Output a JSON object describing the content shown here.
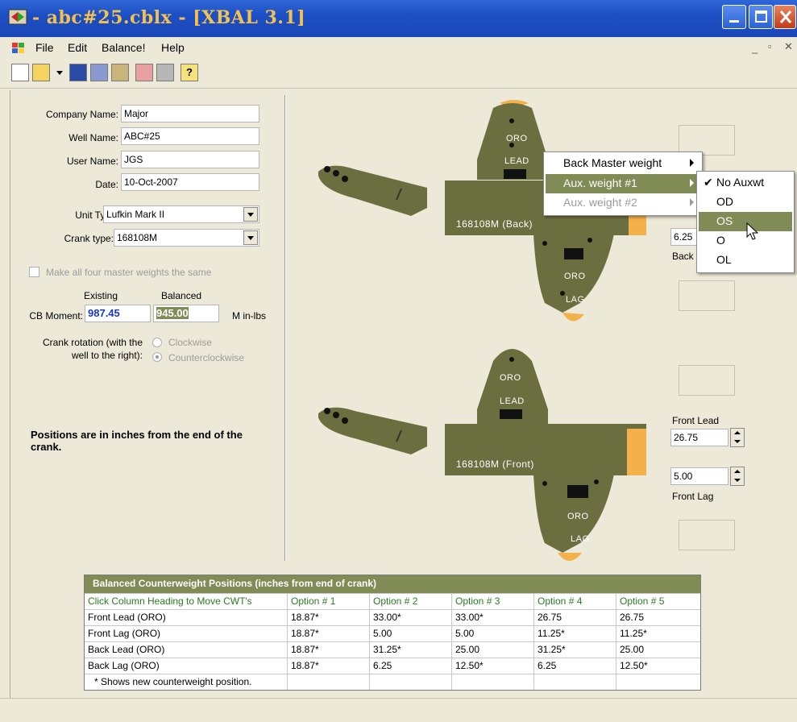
{
  "window": {
    "title": "- abc#25.cblx - [XBAL 3.1]"
  },
  "menu": [
    "File",
    "Edit",
    "Balance!",
    "Help"
  ],
  "form": {
    "company_label": "Company Name:",
    "company_value": "Major",
    "well_label": "Well Name:",
    "well_value": "ABC#25",
    "user_label": "User Name:",
    "user_value": "JGS",
    "date_label": "Date:",
    "date_value": "10-Oct-2007",
    "unit_label": "Unit Type:",
    "unit_value": "Lufkin Mark II",
    "crank_label": "Crank type:",
    "crank_value": "168108M",
    "same_weights_label": "Make all four master weights the same",
    "existing_label": "Existing",
    "balanced_label": "Balanced",
    "cb_label": "CB Moment:",
    "cb_existing": "987.45",
    "cb_balanced": "945.00",
    "cb_unit": "M in-lbs",
    "rotation_label_1": "Crank rotation (with the",
    "rotation_label_2": "well to the right):",
    "clockwise": "Clockwise",
    "counterclockwise": "Counterclockwise",
    "note": "Positions are in inches from the end of the crank."
  },
  "cranks": {
    "back_label": "168108M (Back)",
    "front_label": "168108M (Front)",
    "oro": "ORO",
    "lead": "LEAD",
    "lag": "LAG",
    "back_lead_value": "6.25",
    "back_lag_caption": "Back",
    "front_lead_caption": "Front Lead",
    "front_lead_value": "26.75",
    "front_lag_value": "5.00",
    "front_lag_caption": "Front Lag"
  },
  "context_menu": {
    "items": [
      "Back Master weight",
      "Aux. weight #1",
      "Aux. weight #2"
    ],
    "submenu": [
      "No Auxwt",
      "OD",
      "OS",
      "O",
      "OL"
    ],
    "checked": "✔"
  },
  "table": {
    "title": "Balanced Counterweight Positions (inches from end of crank)",
    "headers": [
      "Click Column Heading to Move CWT's",
      "Option # 1",
      "Option # 2",
      "Option # 3",
      "Option # 4",
      "Option # 5"
    ],
    "rows": [
      [
        "Front Lead (ORO)",
        "18.87*",
        "33.00*",
        "33.00*",
        "26.75",
        "26.75"
      ],
      [
        "Front Lag (ORO)",
        "18.87*",
        "5.00",
        "5.00",
        "11.25*",
        "11.25*"
      ],
      [
        "Back Lead (ORO)",
        "18.87*",
        "31.25*",
        "25.00",
        "31.25*",
        "25.00"
      ],
      [
        "Back Lag (ORO)",
        "18.87*",
        "6.25",
        "12.50*",
        "6.25",
        "12.50*"
      ]
    ],
    "footnote": "* Shows new counterweight position."
  },
  "colors": {
    "olive": "#6b6e3e",
    "accent": "#f4b04a",
    "header_bg": "#808b55"
  }
}
